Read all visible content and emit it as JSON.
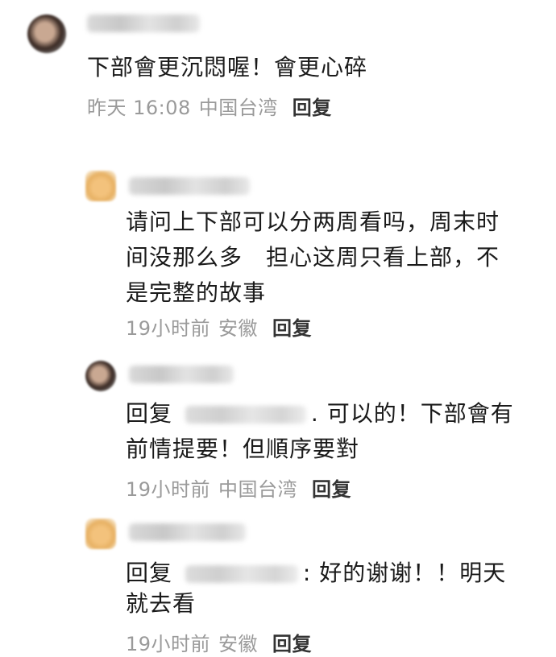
{
  "comments": [
    {
      "text": "下部會更沉悶喔！會更心碎",
      "time": "昨天 16:08",
      "location": "中国台湾",
      "reply_label": "回复"
    },
    {
      "text_line1": "请问上下部可以分两周看吗，周末时",
      "text_line2": "间没那么多　担心这周只看上部，不",
      "text_line3": "是完整的故事",
      "time": "19小时前",
      "location": "安徽",
      "reply_label": "回复"
    },
    {
      "reply_prefix": "回复",
      "text_line1_rest": ". 可以的！下部會有",
      "text_line2": "前情提要！但順序要對",
      "time": "19小时前",
      "location": "中国台湾",
      "reply_label": "回复"
    },
    {
      "reply_prefix": "回复",
      "text_line1_rest": ":  好的谢谢！！明天",
      "text_line2": "就去看",
      "time": "19小时前",
      "location": "安徽",
      "reply_label": "回复"
    }
  ]
}
